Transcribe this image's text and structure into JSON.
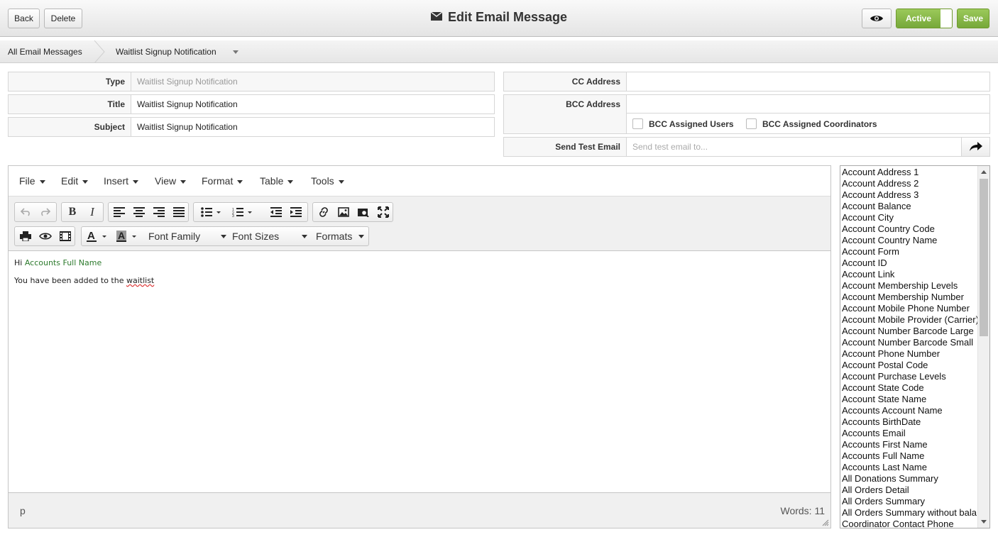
{
  "header": {
    "back_label": "Back",
    "delete_label": "Delete",
    "title": "Edit Email Message",
    "active_label": "Active",
    "save_label": "Save",
    "accent_color": "#77a83a"
  },
  "breadcrumb": {
    "root": "All Email Messages",
    "current": "Waitlist Signup Notification"
  },
  "form": {
    "type_label": "Type",
    "type_value": "Waitlist Signup Notification",
    "title_label": "Title",
    "title_value": "Waitlist Signup Notification",
    "subject_label": "Subject",
    "subject_value": "Waitlist Signup Notification",
    "cc_label": "CC Address",
    "cc_value": "",
    "bcc_label": "BCC Address",
    "bcc_value": "",
    "bcc_users_label": "BCC Assigned Users",
    "bcc_coordinators_label": "BCC Assigned Coordinators",
    "test_label": "Send Test Email",
    "test_placeholder": "Send test email to..."
  },
  "editor": {
    "menus": [
      "File",
      "Edit",
      "Insert",
      "View",
      "Format",
      "Table",
      "Tools"
    ],
    "font_family_label": "Font Family",
    "font_sizes_label": "Font Sizes",
    "formats_label": "Formats",
    "content": {
      "greeting": "Hi",
      "merge_field": "Accounts Full Name",
      "body_text": "You have been added to the",
      "body_misspelled": "waitlist"
    },
    "status_path": "p",
    "word_count": "Words: 11"
  },
  "fields": [
    "Account Address 1",
    "Account Address 2",
    "Account Address 3",
    "Account Balance",
    "Account City",
    "Account Country Code",
    "Account Country Name",
    "Account Form",
    "Account ID",
    "Account Link",
    "Account Membership Levels",
    "Account Membership Number",
    "Account Mobile Phone Number",
    "Account Mobile Provider (Carrier)",
    "Account Number Barcode Large",
    "Account Number Barcode Small",
    "Account Phone Number",
    "Account Postal Code",
    "Account Purchase Levels",
    "Account State Code",
    "Account State Name",
    "Accounts Account Name",
    "Accounts BirthDate",
    "Accounts Email",
    "Accounts First Name",
    "Accounts Full Name",
    "Accounts Last Name",
    "All Donations Summary",
    "All Orders Detail",
    "All Orders Summary",
    "All Orders Summary without bala",
    "Coordinator Contact Phone"
  ]
}
